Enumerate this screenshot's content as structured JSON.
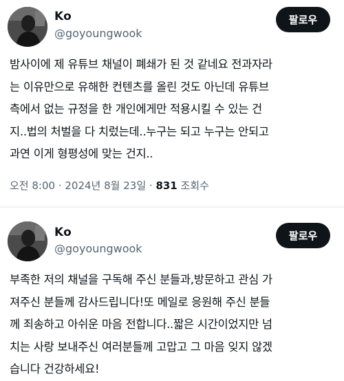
{
  "posts": [
    {
      "author": {
        "name": "Ko",
        "handle": "@goyoungwook"
      },
      "follow_label": "팔로우",
      "text_lines": [
        "밤사이에 제 유튜브 채널이 폐쇄가 된 것 같네요 전과자라",
        "는 이유만으로 유해한 컨텐츠를 올린 것도 아닌데 유튜브",
        "측에서 없는 규정을 한 개인에게만 적용시킬 수 있는 건",
        "지..법의 처벌을 다 치렀는데..누구는 되고 누구는 안되고",
        "과연 이게 형평성에 맞는 건지.."
      ],
      "meta": {
        "time": "오전 8:00",
        "separator": " · ",
        "date": "2024년 8월 23일",
        "views_count": "831",
        "views_label": "조회수"
      }
    },
    {
      "author": {
        "name": "Ko",
        "handle": "@goyoungwook"
      },
      "follow_label": "팔로우",
      "text_lines": [
        "부족한 저의 채널을 구독해 주신 분들과,방문하고 관심 가",
        "져주신 분들께 감사드립니다!또 메일로 응원해 주신 분들",
        "께 죄송하고 아쉬운 마음 전합니다..짧은 시간이었지만 넘",
        "치는 사랑 보내주신 여러분들께 고맙고 그 마음 잊지 않겠",
        "습니다 건강하세요!"
      ]
    }
  ],
  "colors": {
    "text": "#0f1419",
    "secondary": "#536471",
    "button_bg": "#0f1419",
    "button_text": "#ffffff",
    "divider": "#eff3f4"
  }
}
